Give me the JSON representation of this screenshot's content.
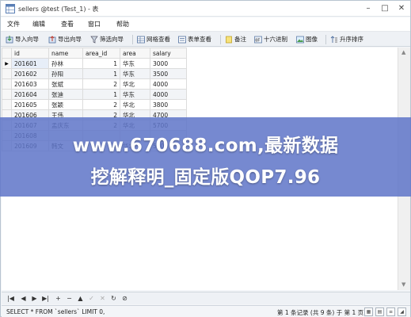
{
  "window": {
    "title": "sellers @test (Test_1) - 表",
    "controls": [
      "minimize-icon",
      "maximize-icon",
      "close-icon"
    ]
  },
  "menu": [
    "文件",
    "编辑",
    "查看",
    "窗口",
    "帮助"
  ],
  "toolbar": [
    {
      "label": "导入向导",
      "icon": "import-icon"
    },
    {
      "label": "导出向导",
      "icon": "export-icon"
    },
    {
      "label": "筛选向导",
      "icon": "filter-icon"
    },
    {
      "label": "网格查看",
      "icon": "grid-view-icon"
    },
    {
      "label": "表单查看",
      "icon": "form-view-icon"
    },
    {
      "label": "备注",
      "icon": "note-icon"
    },
    {
      "label": "十六进制",
      "icon": "hex-icon"
    },
    {
      "label": "图像",
      "icon": "image-icon"
    },
    {
      "label": "升序排序",
      "icon": "sort-asc-icon"
    }
  ],
  "grid": {
    "columns": [
      "id",
      "name",
      "area_id",
      "area",
      "salary"
    ],
    "rows": [
      [
        "201601",
        "孙林",
        "1",
        "华东",
        "3000"
      ],
      [
        "201602",
        "孙阳",
        "1",
        "华东",
        "3500"
      ],
      [
        "201603",
        "张斌",
        "2",
        "华北",
        "4000"
      ],
      [
        "201604",
        "张迪",
        "1",
        "华东",
        "4000"
      ],
      [
        "201605",
        "张颖",
        "2",
        "华北",
        "3800"
      ],
      [
        "201606",
        "王伟",
        "2",
        "华北",
        "4700"
      ],
      [
        "201607",
        "孟庆东",
        "2",
        "华北",
        "5700"
      ],
      [
        "201608",
        "",
        "",
        "",
        ""
      ],
      [
        "201609",
        "韩文",
        "2",
        "华北",
        "5100"
      ]
    ],
    "current_row_marker": "▶"
  },
  "navigator": {
    "buttons": [
      "first-icon",
      "prev-icon",
      "next-icon",
      "last-icon",
      "add-icon",
      "delete-icon",
      "move-up-icon",
      "apply-icon",
      "cancel-icon",
      "refresh-icon",
      "stop-icon"
    ]
  },
  "status": {
    "sql": "SELECT * FROM `sellers` LIMIT 0,",
    "record_info": "第 1 条记录 (共 9 条) 于 第 1 页"
  },
  "banner": {
    "line1": "www.670688.com,最新数据",
    "line2": "挖解释明_固定版QOP7.96"
  },
  "colors": {
    "banner_bg": "#6076c8",
    "toolbar_bg": "#eef1f5",
    "selected_cell": "#e7eef8"
  }
}
